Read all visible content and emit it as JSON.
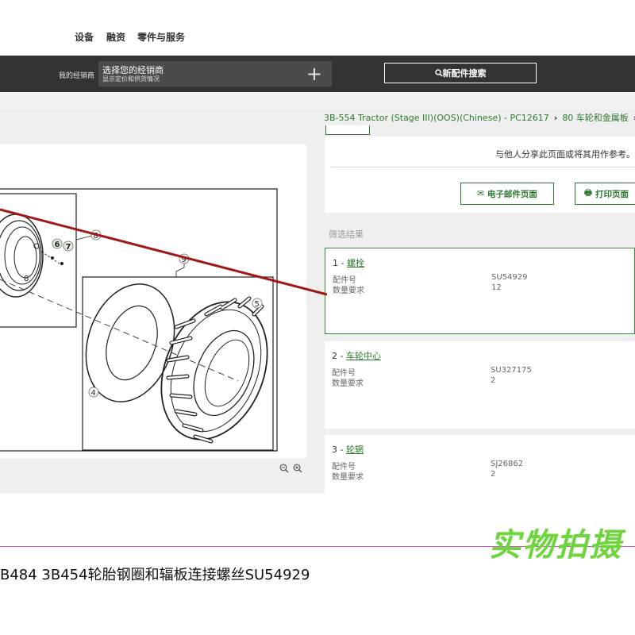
{
  "nav": {
    "items": [
      "设备",
      "融资",
      "零件与服务"
    ]
  },
  "header": {
    "dealer_label": "我的经销商",
    "dealer_title": "选择您的经销商",
    "dealer_subtitle": "显示定价和供货情况",
    "plus_icon": "+",
    "search_button": "新配件搜索"
  },
  "breadcrumb": {
    "items": [
      "3B-554 Tractor (Stage III)(OOS)(Chinese) - PC12617",
      "80 车轮和金属板"
    ]
  },
  "share": {
    "text": "与他人分享此页面或将其用作参考。",
    "email_button": "电子邮件页面",
    "print_button": "打印页面"
  },
  "filter_label": "筛选结果",
  "parts": [
    {
      "index": "1",
      "name": "螺栓",
      "pn_label": "配件号",
      "pn": "SU54929",
      "qty_label": "数量要求",
      "qty": "12"
    },
    {
      "index": "2",
      "name": "车轮中心",
      "pn_label": "配件号",
      "pn": "SU327175",
      "qty_label": "数量要求",
      "qty": "2"
    },
    {
      "index": "3",
      "name": "轮辋",
      "pn_label": "配件号",
      "pn": "SJ26862",
      "qty_label": "数量要求",
      "qty": "2"
    }
  ],
  "diagram": {
    "callouts": [
      "6",
      "7",
      "8",
      "9",
      "5",
      "4"
    ]
  },
  "watermark": "实物拍摄",
  "caption": "B484 3B454轮胎钢圈和辐板连接螺丝SU54929",
  "colors": {
    "accent_green": "#2d7a2d",
    "dark_header": "#333333",
    "annotation_red": "#a01818",
    "watermark_green": "#6ed63c"
  }
}
